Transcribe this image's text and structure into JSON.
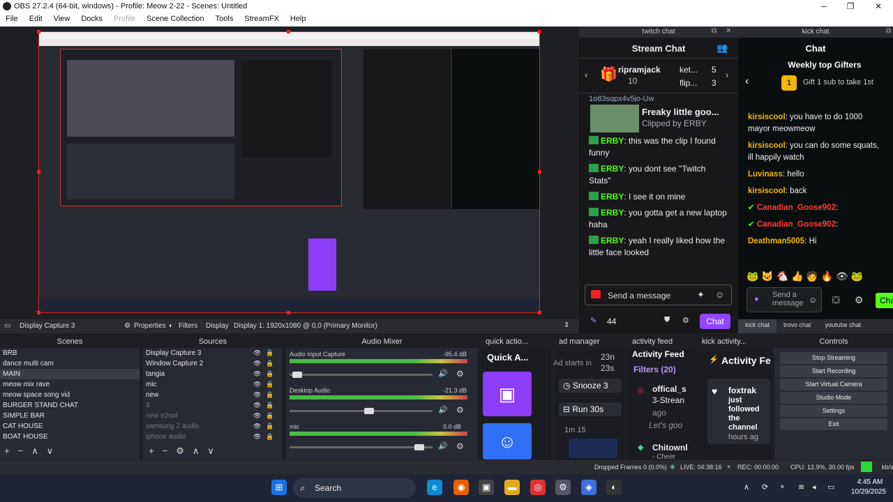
{
  "window": {
    "title": "OBS 27.2.4 (64-bit, windows) - Profile: Meow 2-22 - Scenes: Untitled"
  },
  "menu": [
    "File",
    "Edit",
    "View",
    "Docks",
    "Profile",
    "Scene Collection",
    "Tools",
    "StreamFX",
    "Help"
  ],
  "twitch": {
    "dock_title": "twitch chat",
    "header": "Stream Chat",
    "gifter1": "ripramjack",
    "gifter1_count": "10",
    "gifter2": "ket...",
    "gifter2_count": "5",
    "gifter3": "flip...",
    "gifter3_count": "3",
    "top_cut": "1o83sgpx4v5jo-Uw",
    "clip_title": "Freaky little goo...",
    "clip_by": "Clipped by ERBY",
    "messages": [
      {
        "user": "ERBY",
        "text": ": this was the clip I found funny"
      },
      {
        "user": "ERBY",
        "text": ": you dont see \"Twitch Stats\""
      },
      {
        "user": "ERBY",
        "text": ": I see it on mine"
      },
      {
        "user": "ERBY",
        "text": ": you gotta get a new laptop haha"
      },
      {
        "user": "ERBY",
        "text": ": yeah I really liked how the little face looked"
      }
    ],
    "send_placeholder": "Send a message",
    "points": "44",
    "chat_button": "Chat"
  },
  "kick": {
    "dock_title": "kick chat",
    "header": "Chat",
    "gifters_title": "Weekly top Gifters",
    "gift_cta": "Gift 1 sub to take 1st",
    "rank": "1",
    "messages": [
      {
        "user": "kirsiscool",
        "text": ": you have to do 1000 mayor meowmeow",
        "cls": "y"
      },
      {
        "user": "kirsiscool",
        "text": ": you can do some squats, ill happily watch",
        "cls": "y"
      },
      {
        "user": "Luvinass",
        "text": ": hello",
        "cls": "y"
      },
      {
        "user": "kirsiscool",
        "text": ": back",
        "cls": "y"
      },
      {
        "user": "Canadian_Goose902",
        "text": ":",
        "cls": "r"
      },
      {
        "user": "Canadian_Goose902",
        "text": ":",
        "cls": "r"
      },
      {
        "user": "Deathman5005",
        "text": ": Hi",
        "cls": "y"
      }
    ],
    "send_placeholder": "Send a message",
    "chat_button": "Chat",
    "tabs": [
      "kick chat",
      "trovo chat",
      "youtube chat"
    ]
  },
  "status_row": {
    "source": "Display Capture 3",
    "properties": "Properties",
    "filters": "Filters",
    "display": "Display",
    "display_value": "Display 1: 1920x1080 @ 0,0 (Primary Monitor)"
  },
  "panels": {
    "scenes": "Scenes",
    "sources": "Sources",
    "mixer": "Audio Mixer",
    "quick": "quick actio...",
    "ad": "ad manager",
    "activity": "activity feed",
    "kickact": "kick activity...",
    "controls": "Controls"
  },
  "scenes": [
    "BRB",
    "dance multi cam",
    "MAIN",
    "meow mix rave",
    "meow space song vid",
    "BURGER STAND CHAT",
    "SIMPLE BAR",
    "CAT HOUSE",
    "BOAT HOUSE"
  ],
  "selected_scene": "MAIN",
  "sources": [
    {
      "name": "Display Capture 3",
      "dim": false
    },
    {
      "name": "Window Capture 2",
      "dim": false
    },
    {
      "name": "tangia",
      "dim": false
    },
    {
      "name": "mic",
      "dim": false
    },
    {
      "name": "new",
      "dim": false
    },
    {
      "name": "3",
      "dim": true
    },
    {
      "name": "new e2sot",
      "dim": true
    },
    {
      "name": "samsung 2 audio",
      "dim": true
    },
    {
      "name": "iphone audio",
      "dim": true
    }
  ],
  "mixer": [
    {
      "name": "Audio Input Capture",
      "db": "-95.4 dB",
      "level": 0.02
    },
    {
      "name": "Desktop Audio",
      "db": "-21.3 dB",
      "level": 0.55
    },
    {
      "name": "mic",
      "db": "0.0 dB",
      "level": 0.92
    }
  ],
  "quick": {
    "title": "Quick A..."
  },
  "ad": {
    "starts": "Ad starts in",
    "time1": "23n",
    "time2": "23s",
    "snooze": "Snooze 3",
    "run": "Run 30s",
    "ticks": "1m 15"
  },
  "activity": {
    "title": "Activity Feed",
    "filters": "Filters (20)",
    "item1": "offical_s",
    "item1b": "3-Strean",
    "item1c": "ago",
    "item2": "Let's goo",
    "item3": "Chitownl",
    "item3b": "- Cheer"
  },
  "kickact": {
    "title": "Activity Fe",
    "user": "foxtrak",
    "line1": "just",
    "line2": "followed",
    "line3": "the",
    "line4": "channel",
    "ago": "hours ag"
  },
  "controls": [
    "Stop Streaming",
    "Start Recording",
    "Start Virtual Camera",
    "Studio Mode",
    "Settings",
    "Exit"
  ],
  "statusbar": {
    "dropped": "Dropped Frames 0 (0.0%)",
    "live": "LIVE: 04:38:16",
    "rec": "REC: 00:00:00",
    "cpu": "CPU: 12.9%, 30.00 fps",
    "kb": "kb/s"
  },
  "taskbar": {
    "search": "Search",
    "time": "4:45 AM",
    "date": "10/29/2025"
  },
  "colors": {
    "twitch_purple": "#9147ff",
    "kick_green": "#53fc18",
    "obs_panel": "#272a33"
  }
}
